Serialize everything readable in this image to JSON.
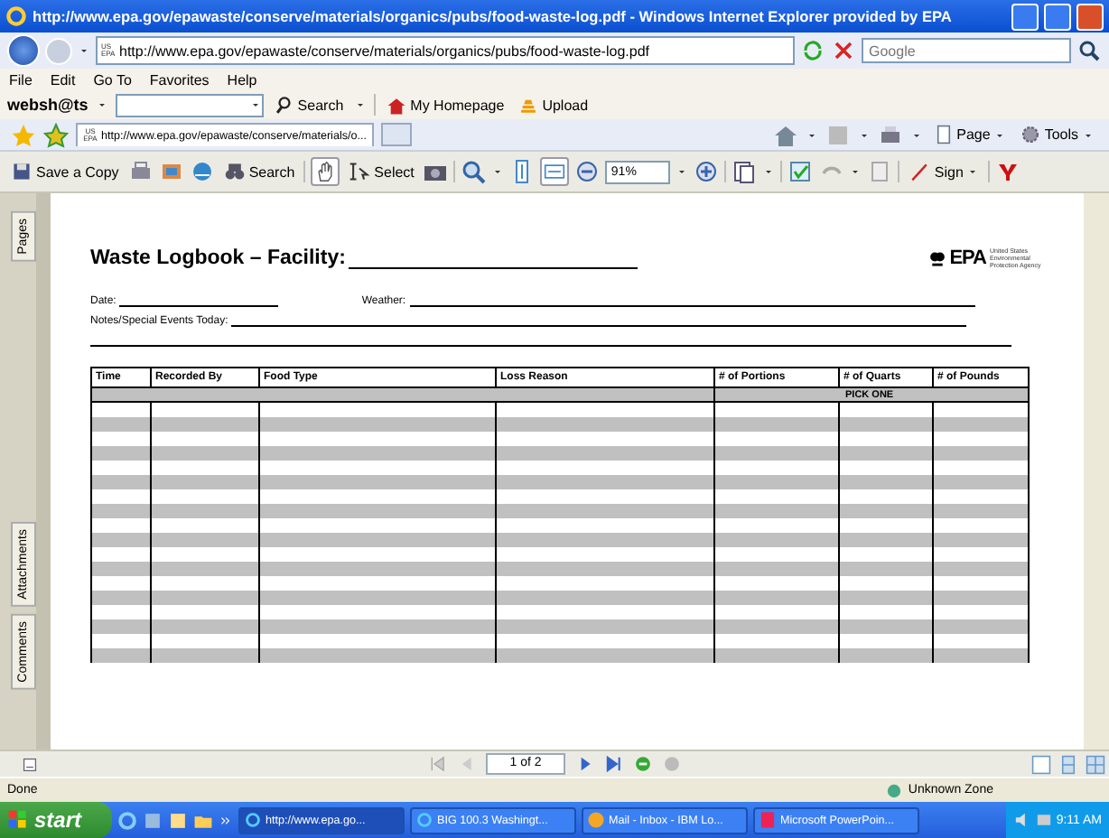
{
  "window": {
    "title": "http://www.epa.gov/epawaste/conserve/materials/organics/pubs/food-waste-log.pdf - Windows Internet Explorer provided by EPA"
  },
  "address_bar": {
    "site_badge": "US EPA",
    "url": "http://www.epa.gov/epawaste/conserve/materials/organics/pubs/food-waste-log.pdf",
    "search_placeholder": "Google"
  },
  "menu": [
    "File",
    "Edit",
    "Go To",
    "Favorites",
    "Help"
  ],
  "webshots_toolbar": {
    "brand": "websh@ts",
    "search": "Search",
    "homepage": "My Homepage",
    "upload": "Upload"
  },
  "tabs": [
    {
      "badge": "US EPA",
      "label": "http://www.epa.gov/epawaste/conserve/materials/o...",
      "selected": true
    }
  ],
  "command_bar": {
    "page": "Page",
    "tools": "Tools"
  },
  "reader_toolbar": {
    "save": "Save a Copy",
    "search": "Search",
    "select": "Select",
    "zoom": "91%",
    "sign": "Sign"
  },
  "side_tabs": [
    "Pages",
    "Attachments",
    "Comments"
  ],
  "document": {
    "title": "Waste Logbook – Facility:",
    "logo": "EPA",
    "agency": "United States Environmental Protection Agency",
    "date_label": "Date:",
    "weather_label": "Weather:",
    "notes_label": "Notes/Special Events Today:",
    "columns": [
      "Time",
      "Recorded By",
      "Food Type",
      "Loss Reason",
      "# of Portions",
      "# of Quarts",
      "# of Pounds"
    ],
    "subheader": "PICK ONE"
  },
  "page_nav": {
    "page": "1 of 2"
  },
  "status_bar": {
    "text": "Done",
    "zone": "Unknown Zone"
  },
  "taskbar": {
    "start": "start",
    "tasks": [
      {
        "label": "http://www.epa.go...",
        "selected": true
      },
      {
        "label": "BIG 100.3 Washingt...",
        "selected": false
      },
      {
        "label": "Mail - Inbox - IBM Lo...",
        "selected": false
      },
      {
        "label": "Microsoft PowerPoin...",
        "selected": false
      }
    ],
    "clock": "9:11 AM"
  }
}
